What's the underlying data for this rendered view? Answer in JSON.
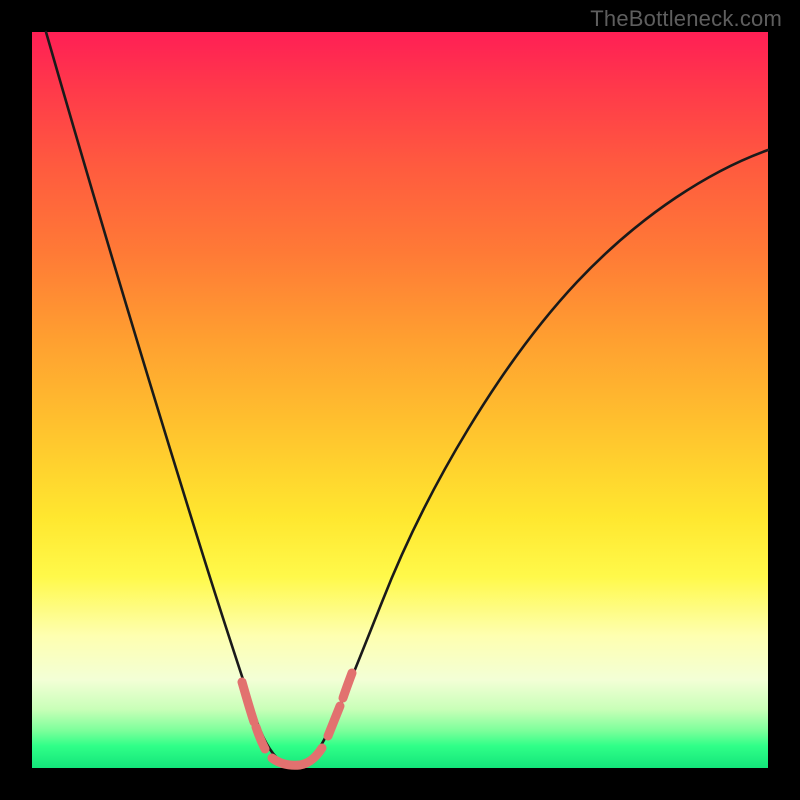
{
  "watermark": "TheBottleneck.com",
  "colors": {
    "frame": "#000000",
    "watermark_text": "#5e5e5e",
    "gradient_top": "#ff1f55",
    "gradient_mid": "#ffe72f",
    "gradient_bottom": "#13e57a",
    "curve": "#1a1a1a",
    "pink_accent": "#e2716f"
  },
  "chart_data": {
    "type": "line",
    "title": "",
    "xlabel": "",
    "ylabel": "",
    "xlim": [
      0,
      100
    ],
    "ylim": [
      0,
      100
    ],
    "grid": false,
    "legend": false,
    "annotations": [
      "TheBottleneck.com"
    ],
    "series": [
      {
        "name": "curve",
        "x": [
          2,
          6,
          10,
          14,
          18,
          22,
          24,
          26,
          28,
          29.5,
          31,
          32.5,
          34,
          35.5,
          37,
          38.5,
          40,
          42,
          44,
          48,
          54,
          60,
          66,
          72,
          78,
          84,
          90,
          96,
          100
        ],
        "y": [
          100,
          89,
          78,
          67,
          56,
          44,
          38,
          31,
          24,
          18,
          12,
          7,
          3,
          1,
          0.5,
          1,
          2.5,
          5,
          9,
          18,
          31,
          42,
          51,
          58,
          64,
          68,
          72,
          74,
          75
        ]
      }
    ],
    "trough": {
      "x": 35.5,
      "y": 0.5
    },
    "pink_marker_ranges_x": [
      [
        28,
        30
      ],
      [
        32,
        40
      ],
      [
        41,
        43
      ]
    ]
  }
}
